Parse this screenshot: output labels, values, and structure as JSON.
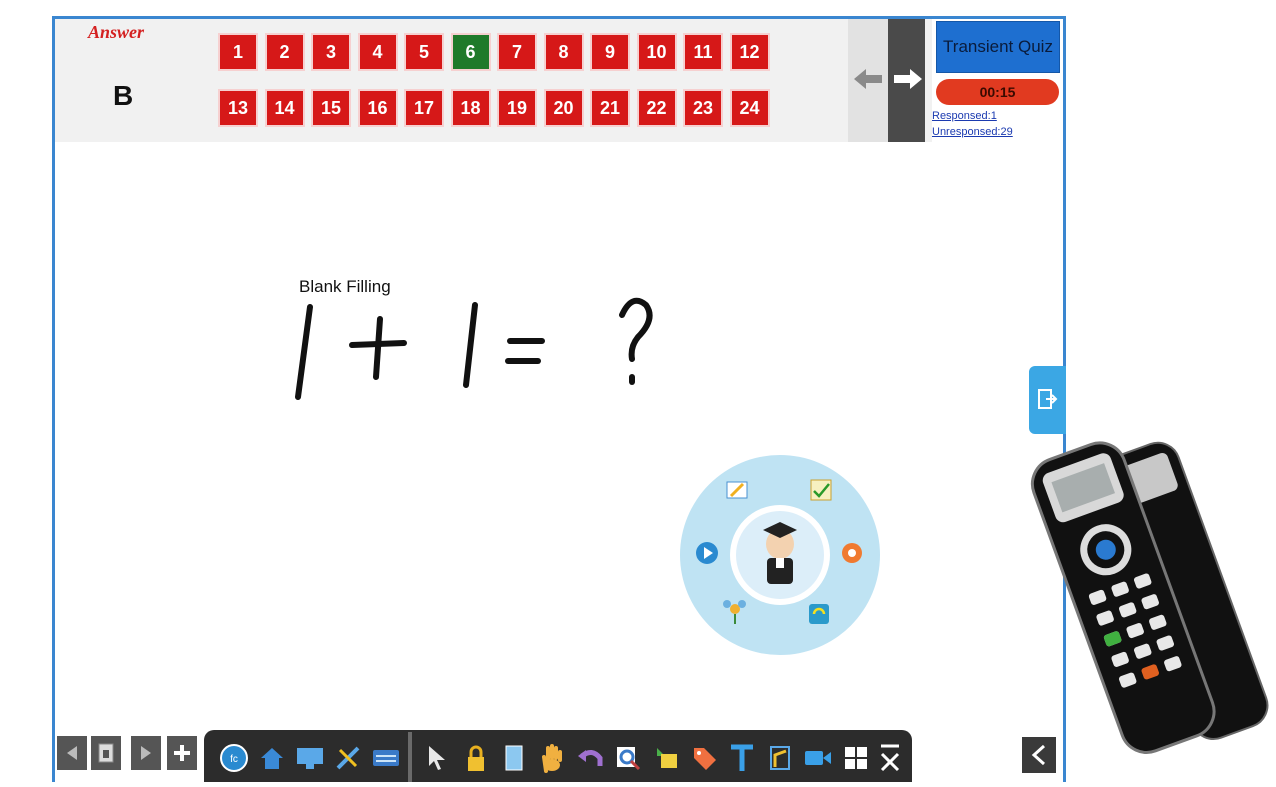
{
  "answer": {
    "label": "Answer",
    "value": "B"
  },
  "questions": {
    "row1": [
      "1",
      "2",
      "3",
      "4",
      "5",
      "6",
      "7",
      "8",
      "9",
      "10",
      "11",
      "12"
    ],
    "row2": [
      "13",
      "14",
      "15",
      "16",
      "17",
      "18",
      "19",
      "20",
      "21",
      "22",
      "23",
      "24"
    ],
    "active": "6"
  },
  "quiz": {
    "button_label": "Transient Quiz",
    "timer": "00:15",
    "responsed": "Responsed:1",
    "unresponsed": "Unresponsed:29"
  },
  "canvas": {
    "title": "Blank Filling",
    "handwriting": "1 + 1 = ?"
  },
  "wheel": {
    "center_icon": "graduate-avatar-icon",
    "items": [
      "edit-pencil-icon",
      "checklist-icon",
      "record-icon",
      "refresh-icon",
      "flower-icon",
      "play-icon"
    ]
  },
  "toolbar": {
    "left": [
      "prev-page-icon",
      "page-icon",
      "next-page-icon",
      "add-page-icon"
    ],
    "dock": [
      "app-logo-icon",
      "home-icon",
      "screen-icon",
      "tools-icon",
      "keyboard-icon",
      "select-arrow-icon",
      "lock-icon",
      "board-icon",
      "hand-icon",
      "undo-icon",
      "zoom-icon",
      "shapes-icon",
      "tag-icon",
      "text-icon",
      "camera-doc-icon",
      "video-icon",
      "grid-icon",
      "close-icon"
    ]
  },
  "colors": {
    "accent": "#3a86d0",
    "question": "#d61818",
    "active_question": "#1f7a2a",
    "quiz": "#1e6fd0",
    "timer": "#e13a20"
  }
}
